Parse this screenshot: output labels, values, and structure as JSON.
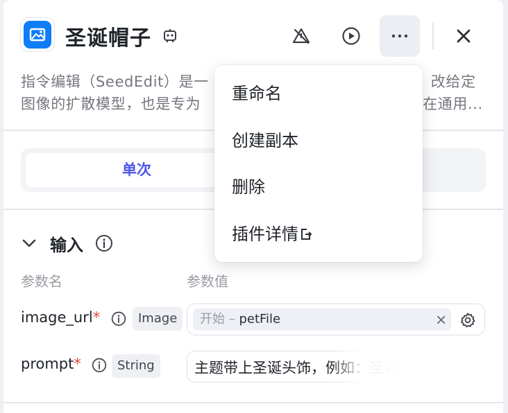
{
  "header": {
    "title": "圣诞帽子",
    "icons": [
      "image-app-icon",
      "bot-icon",
      "warning-off-icon",
      "play-icon",
      "more-icon",
      "close-icon"
    ]
  },
  "description": {
    "line1_left": "指令编辑（SeedEdit）是一",
    "line1_right": "改给定",
    "line2_left": "图像的扩散模型，也是专为",
    "line2_right": "在通用..."
  },
  "tabs": {
    "selected_label": "单次"
  },
  "input_section": {
    "title": "输入",
    "col_name_header": "参数名",
    "col_value_header": "参数值",
    "params": [
      {
        "name": "image_url",
        "required_mark": "*",
        "type": "Image",
        "ref_prefix": "开始 – ",
        "ref_value": "petFile",
        "clear": "×"
      },
      {
        "name": "prompt",
        "required_mark": "*",
        "type": "String",
        "value": "主题带上圣诞头饰，例如：圣诞帽"
      }
    ]
  },
  "menu": {
    "items": [
      "重命名",
      "创建副本",
      "删除",
      "插件详情"
    ]
  },
  "colors": {
    "accent": "#4d53e8",
    "required": "#e8443a",
    "app_icon": "#0e7df6"
  }
}
